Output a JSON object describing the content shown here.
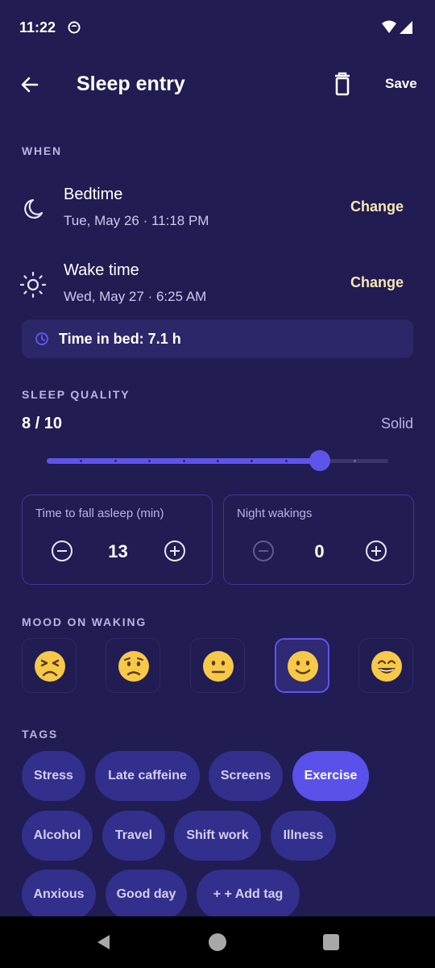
{
  "status_bar": {
    "time": "11:22"
  },
  "app_bar": {
    "title": "Sleep entry",
    "save_label": "Save"
  },
  "when": {
    "section_label": "WHEN",
    "bedtime": {
      "title": "Bedtime",
      "value": "Tue, May 26 · 11:18 PM",
      "action": "Change"
    },
    "wake_time": {
      "title": "Wake time",
      "value": "Wed, May 27 · 6:25 AM",
      "action": "Change"
    },
    "time_in_bed": "Time in bed: 7.1 h"
  },
  "sleep_quality": {
    "section_label": "SLEEP QUALITY",
    "value_text": "8 / 10",
    "descriptor": "Solid",
    "value": 8,
    "min": 0,
    "max": 10,
    "accent_color": "#5d55ea"
  },
  "steppers": [
    {
      "label": "Time to fall asleep (min)",
      "value": "13",
      "minus_enabled": true
    },
    {
      "label": "Night wakings",
      "value": "0",
      "minus_enabled": false
    }
  ],
  "mood": {
    "section_label": "MOOD ON WAKING",
    "options": [
      "tired-face-icon",
      "worried-face-icon",
      "neutral-face-icon",
      "slightly-smiling-face-icon",
      "grinning-face-icon"
    ],
    "selected_index": 3
  },
  "tags": {
    "section_label": "TAGS",
    "items": [
      {
        "label": "Stress",
        "selected": false
      },
      {
        "label": "Late caffeine",
        "selected": false
      },
      {
        "label": "Screens",
        "selected": false
      },
      {
        "label": "Exercise",
        "selected": true
      },
      {
        "label": "Alcohol",
        "selected": false
      },
      {
        "label": "Travel",
        "selected": false
      },
      {
        "label": "Shift work",
        "selected": false
      },
      {
        "label": "Illness",
        "selected": false
      },
      {
        "label": "Anxious",
        "selected": false
      },
      {
        "label": "Good day",
        "selected": false
      },
      {
        "label": "+ + Add tag",
        "selected": false
      }
    ]
  },
  "colors": {
    "background": "#211c52",
    "accent": "#5d55ea",
    "change_text": "#f7e7b1"
  }
}
